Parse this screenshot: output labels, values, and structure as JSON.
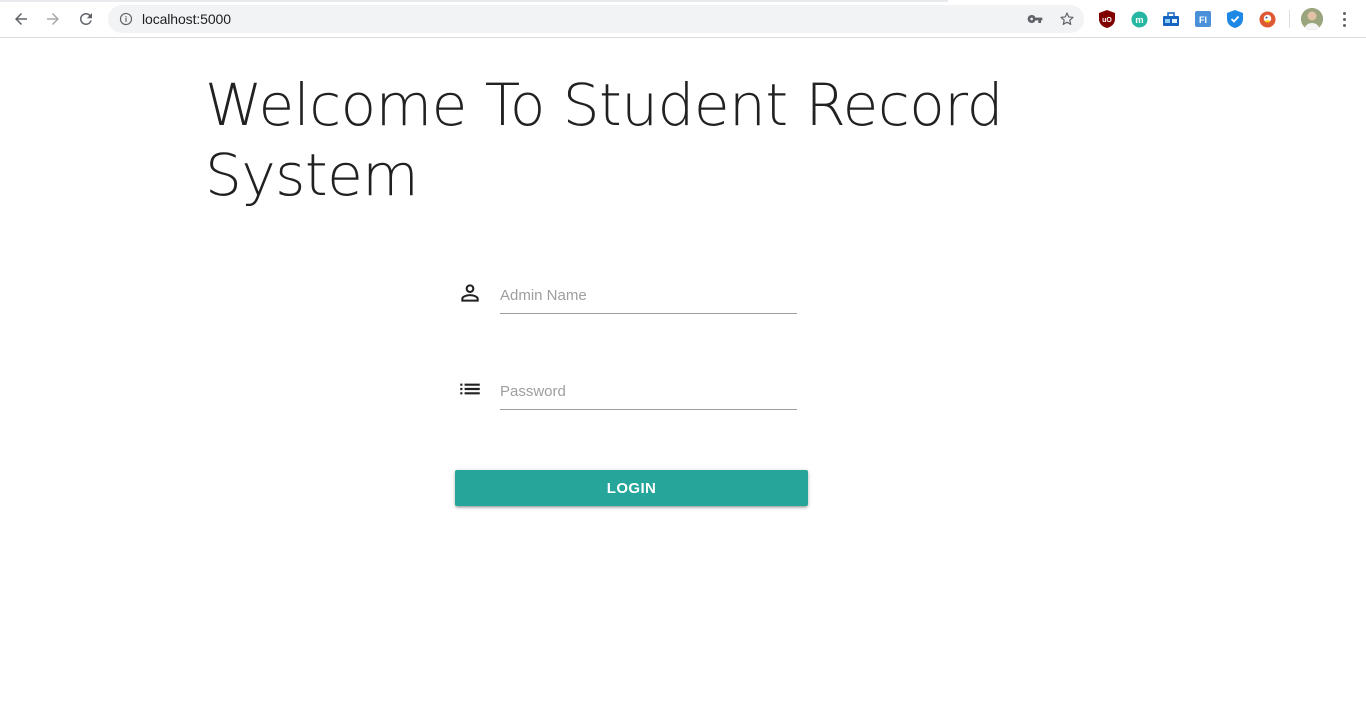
{
  "browser": {
    "url": "localhost:5000",
    "nav": [
      {
        "name": "back-button",
        "icon": "arrow-left-icon"
      },
      {
        "name": "forward-button",
        "icon": "arrow-right-icon"
      },
      {
        "name": "reload-button",
        "icon": "reload-icon"
      }
    ],
    "extensions": [
      {
        "name": "ublock-origin-extension",
        "icon": "ublock-icon",
        "color": "#800000",
        "glyph": "uD"
      },
      {
        "name": "mercury-extension",
        "icon": "m-circle-icon",
        "color": "#26b7a3",
        "glyph": "m"
      },
      {
        "name": "toolbox-extension",
        "icon": "toolbox-icon",
        "color": "#1565c0",
        "glyph": ""
      },
      {
        "name": "fi-extension",
        "icon": "fi-icon",
        "color": "#4a90d9",
        "glyph": "FI"
      },
      {
        "name": "shield-extension",
        "icon": "shield-check-icon",
        "color": "#1e88e5",
        "glyph": ""
      },
      {
        "name": "duckduckgo-extension",
        "icon": "duckduckgo-icon",
        "color": "#de5833",
        "glyph": ""
      }
    ]
  },
  "page": {
    "title": "Welcome To Student Record System",
    "fields": {
      "admin_name": {
        "placeholder": "Admin Name",
        "value": "",
        "icon": "person-icon"
      },
      "password": {
        "placeholder": "Password",
        "value": "",
        "icon": "list-icon"
      }
    },
    "login_label": "LOGIN"
  },
  "colors": {
    "accent": "#26a69a",
    "text": "#212121",
    "placeholder": "#9e9e9e",
    "underline": "#9e9e9e"
  }
}
